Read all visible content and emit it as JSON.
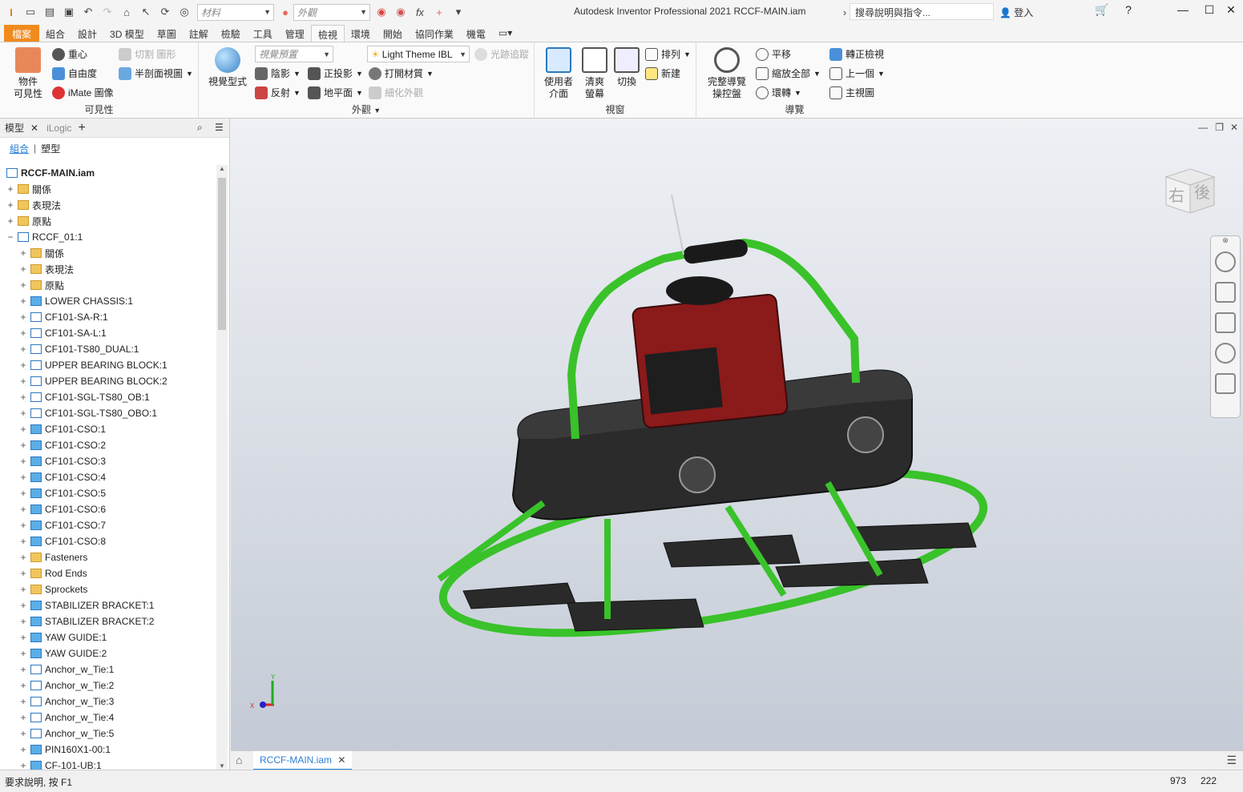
{
  "titlebar": {
    "app_title": "Autodesk Inventor Professional 2021   RCCF-MAIN.iam",
    "material_placeholder": "材料",
    "appearance_placeholder": "外觀",
    "search_placeholder": "搜尋說明與指令...",
    "login": "登入"
  },
  "tabs": [
    "檔案",
    "組合",
    "設計",
    "3D 模型",
    "草圖",
    "註解",
    "檢驗",
    "工具",
    "管理",
    "檢視",
    "環境",
    "開始",
    "協同作業",
    "機電"
  ],
  "active_tab": "檢視",
  "ribbon": {
    "visibility": {
      "label": "可見性",
      "object_visibility": "物件\n可見性",
      "center_of_gravity": "重心",
      "degrees_of_freedom": "自由度",
      "imate_glyph": "iMate 圖像",
      "slice_graphics": "切割 圖形",
      "half_section": "半剖面視圖"
    },
    "appearance": {
      "label": "外觀",
      "visual_style": "視覺型式",
      "view_preset": "視覺預置",
      "lighting": "Light Theme IBL",
      "ray_tracing": "光跡追蹤",
      "shadows": "陰影",
      "orthographic": "正投影",
      "textures_on": "打開材質",
      "reflections": "反射",
      "ground_plane": "地平面",
      "refine_appearance": "細化外觀"
    },
    "windows": {
      "label": "視窗",
      "user_interface": "使用者\n介面",
      "clean_screen": "清爽\n螢幕",
      "switch": "切換",
      "arrange": "排列",
      "new": "新建"
    },
    "navigate": {
      "label": "導覽",
      "full_navigation_wheel": "完整導覽\n操控盤",
      "pan": "平移",
      "zoom_all": "縮放全部",
      "orbit": "環轉",
      "look_at": "轉正檢視",
      "previous": "上一個",
      "home_view": "主視圖"
    }
  },
  "browser": {
    "tab_model": "模型",
    "tab_ilogic": "iLogic",
    "sub_assembly": "組合",
    "sub_modeling": "塑型",
    "root": "RCCF-MAIN.iam",
    "nodes": [
      {
        "label": "關係",
        "type": "folder",
        "level": 1
      },
      {
        "label": "表現法",
        "type": "folder",
        "level": 1
      },
      {
        "label": "原點",
        "type": "folder",
        "level": 1
      },
      {
        "label": "RCCF_01:1",
        "type": "asm",
        "level": 1
      },
      {
        "label": "關係",
        "type": "folder",
        "level": 2
      },
      {
        "label": "表現法",
        "type": "folder",
        "level": 2
      },
      {
        "label": "原點",
        "type": "folder",
        "level": 2
      },
      {
        "label": "LOWER CHASSIS:1",
        "type": "part",
        "level": 2
      },
      {
        "label": "CF101-SA-R:1",
        "type": "asm",
        "level": 2
      },
      {
        "label": "CF101-SA-L:1",
        "type": "asm",
        "level": 2
      },
      {
        "label": "CF101-TS80_DUAL:1",
        "type": "asm",
        "level": 2
      },
      {
        "label": "UPPER BEARING BLOCK:1",
        "type": "asm",
        "level": 2
      },
      {
        "label": "UPPER BEARING BLOCK:2",
        "type": "asm",
        "level": 2
      },
      {
        "label": "CF101-SGL-TS80_OB:1",
        "type": "asm",
        "level": 2
      },
      {
        "label": "CF101-SGL-TS80_OBO:1",
        "type": "asm",
        "level": 2
      },
      {
        "label": "CF101-CSO:1",
        "type": "part",
        "level": 2
      },
      {
        "label": "CF101-CSO:2",
        "type": "part",
        "level": 2
      },
      {
        "label": "CF101-CSO:3",
        "type": "part",
        "level": 2
      },
      {
        "label": "CF101-CSO:4",
        "type": "part",
        "level": 2
      },
      {
        "label": "CF101-CSO:5",
        "type": "part",
        "level": 2
      },
      {
        "label": "CF101-CSO:6",
        "type": "part",
        "level": 2
      },
      {
        "label": "CF101-CSO:7",
        "type": "part",
        "level": 2
      },
      {
        "label": "CF101-CSO:8",
        "type": "part",
        "level": 2
      },
      {
        "label": "Fasteners",
        "type": "folder",
        "level": 2
      },
      {
        "label": "Rod Ends",
        "type": "folder",
        "level": 2
      },
      {
        "label": "Sprockets",
        "type": "folder",
        "level": 2
      },
      {
        "label": "STABILIZER BRACKET:1",
        "type": "part",
        "level": 2
      },
      {
        "label": "STABILIZER BRACKET:2",
        "type": "part",
        "level": 2
      },
      {
        "label": "YAW GUIDE:1",
        "type": "part",
        "level": 2
      },
      {
        "label": "YAW GUIDE:2",
        "type": "part",
        "level": 2
      },
      {
        "label": "Anchor_w_Tie:1",
        "type": "asm",
        "level": 2
      },
      {
        "label": "Anchor_w_Tie:2",
        "type": "asm",
        "level": 2
      },
      {
        "label": "Anchor_w_Tie:3",
        "type": "asm",
        "level": 2
      },
      {
        "label": "Anchor_w_Tie:4",
        "type": "asm",
        "level": 2
      },
      {
        "label": "Anchor_w_Tie:5",
        "type": "asm",
        "level": 2
      },
      {
        "label": "PIN160X1-00:1",
        "type": "part",
        "level": 2
      },
      {
        "label": "CF-101-UB:1",
        "type": "part",
        "level": 2
      }
    ]
  },
  "viewcube": {
    "right": "右",
    "back": "後"
  },
  "document_tab": "RCCF-MAIN.iam",
  "status": {
    "text": "要求說明, 按 F1",
    "x": "973",
    "y": "222"
  }
}
